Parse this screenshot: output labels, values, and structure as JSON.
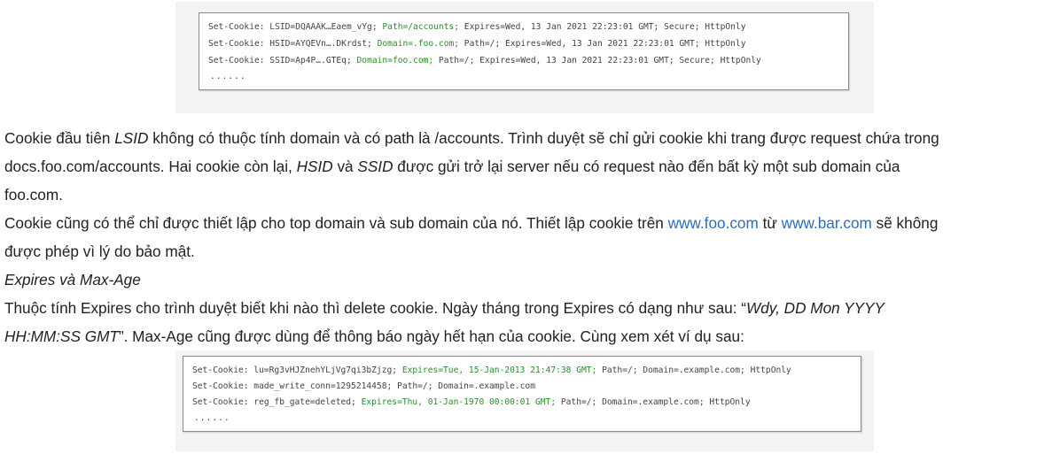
{
  "figure1": {
    "lines": [
      {
        "a": "Set-Cookie: LSID=DQAAAK…Eaem_vYg; ",
        "g": "Path=/accounts;",
        "b": " Expires=Wed, 13 Jan 2021 22:23:01 GMT; Secure; HttpOnly"
      },
      {
        "a": "Set-Cookie: HSID=AYQEVn….DKrdst; ",
        "g": "Domain=.foo.com;",
        "b": " Path=/; Expires=Wed, 13 Jan 2021 22:23:01 GMT; HttpOnly"
      },
      {
        "a": "Set-Cookie: SSID=Ap4P….GTEq; ",
        "g": "Domain=foo.com;",
        "b": " Path=/; Expires=Wed, 13 Jan 2021 22:23:01 GMT; Secure; HttpOnly"
      }
    ],
    "ellipsis": "......"
  },
  "para1": {
    "t1": "Cookie đầu tiên ",
    "i1": "LSID",
    "t2": " không có thuộc tính domain và có path là /accounts. Trình duyệt sẽ chỉ gửi cookie khi trang được request chứa trong",
    "l2": "docs.foo.com/accounts. Hai cookie còn lại, ",
    "i2": "HSID",
    "t3": " và ",
    "i3": "SSID",
    "t4": " được gửi trở lại server nếu có request nào đến bất kỳ một sub domain của",
    "l3": "foo.com."
  },
  "para2": {
    "t1": "Cookie cũng có thể chỉ được thiết lập cho top domain và sub domain của nó. Thiết lập cookie trên ",
    "link1": "www.foo.com",
    "t2": " từ ",
    "link2": "www.bar.com",
    "t3": " sẽ không",
    "l2": "được phép vì lý do bảo mật."
  },
  "heading": "Expires và Max-Age",
  "para3": {
    "t1": "Thuộc tính Expires cho trình duyệt biết khi nào thì delete cookie. Ngày tháng trong Expires có dạng như sau: “",
    "i1": "Wdy, DD Mon YYYY",
    "i2": "HH:MM:SS GMT",
    "t2": "”. Max-Age cũng được dùng để thông báo ngày hết hạn của cookie. Cùng xem xét ví dụ sau:"
  },
  "figure2": {
    "lines": [
      {
        "a": "Set-Cookie: lu=Rg3vHJZnehYLjVg7qi3bZjzg; ",
        "g": "Expires=Tue, 15-Jan-2013 21:47:38 GMT;",
        "b": " Path=/; Domain=.example.com; HttpOnly"
      },
      {
        "a": "Set-Cookie: made_write_conn=1295214458; Path=/; Domain=.example.com",
        "g": "",
        "b": ""
      },
      {
        "a": "Set-Cookie: reg_fb_gate=deleted; ",
        "g": "Expires=Thu, 01-Jan-1970 00:00:01 GMT;",
        "b": " Path=/; Domain=.example.com; HttpOnly"
      }
    ],
    "ellipsis": "......"
  }
}
